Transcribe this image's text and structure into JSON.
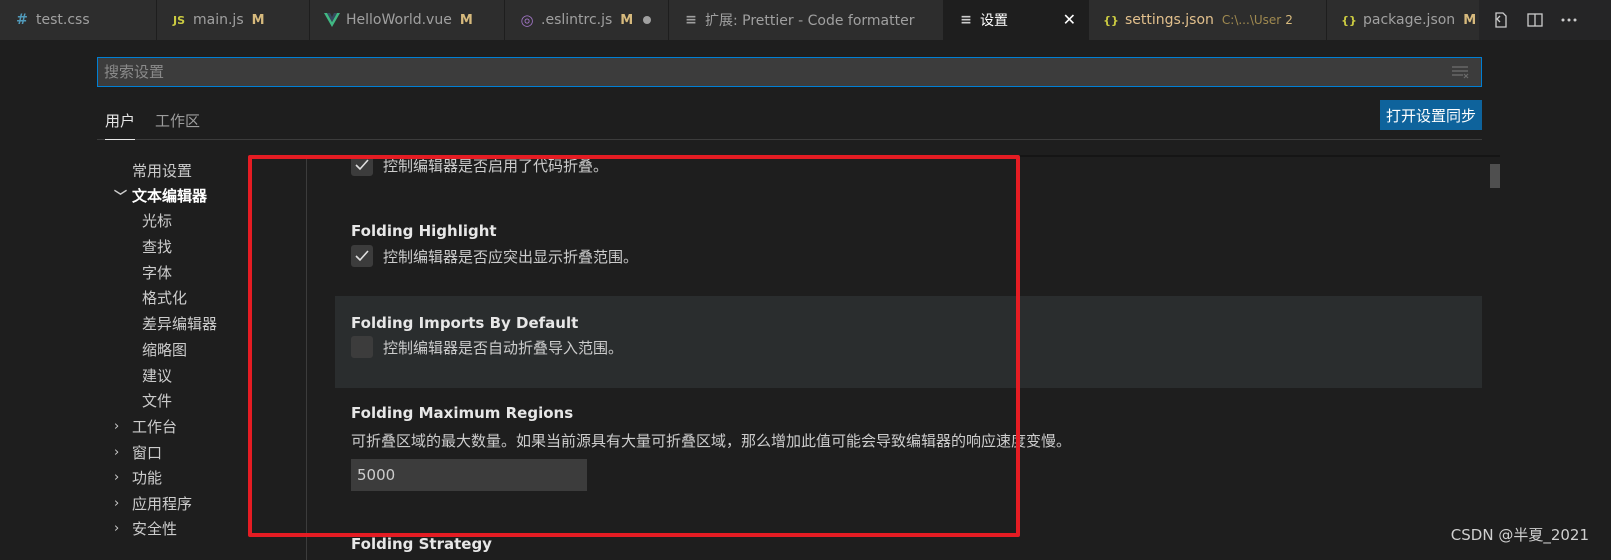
{
  "tabs": [
    {
      "label": "test.css",
      "icon": "#",
      "icon_color": "#519aba",
      "modified": ""
    },
    {
      "label": "main.js",
      "icon": "JS",
      "icon_color": "#cbcb41",
      "modified": "M"
    },
    {
      "label": "HelloWorld.vue",
      "icon": "V",
      "icon_color": "#8dc149",
      "modified": "M"
    },
    {
      "label": ".eslintrc.js",
      "icon": "◎",
      "icon_color": "#a074c4",
      "modified": "M"
    },
    {
      "label": "扩展: Prettier - Code formatter",
      "icon": "≡",
      "icon_color": "#a0a0a0",
      "modified": ""
    },
    {
      "label": "设置",
      "icon": "≡",
      "icon_color": "#cccccc",
      "modified": "",
      "close": "✕"
    },
    {
      "label": "settings.json",
      "sub": "C:\\...\\User",
      "count": "2",
      "icon": "{}",
      "icon_color": "#cbcb41"
    },
    {
      "label": "package.json",
      "icon": "{}",
      "icon_color": "#cbcb41",
      "modified": "M"
    }
  ],
  "search": {
    "placeholder": "搜索设置"
  },
  "scope": {
    "user": "用户",
    "workspace": "工作区",
    "sync_button": "打开设置同步"
  },
  "toc": [
    {
      "label": "常用设置",
      "chevron": ""
    },
    {
      "label": "文本编辑器",
      "chevron": "﹀"
    },
    {
      "label": "光标",
      "chevron": ""
    },
    {
      "label": "查找",
      "chevron": ""
    },
    {
      "label": "字体",
      "chevron": ""
    },
    {
      "label": "格式化",
      "chevron": ""
    },
    {
      "label": "差异编辑器",
      "chevron": ""
    },
    {
      "label": "缩略图",
      "chevron": ""
    },
    {
      "label": "建议",
      "chevron": ""
    },
    {
      "label": "文件",
      "chevron": ""
    },
    {
      "label": "工作台",
      "chevron": "›"
    },
    {
      "label": "窗口",
      "chevron": "›"
    },
    {
      "label": "功能",
      "chevron": "›"
    },
    {
      "label": "应用程序",
      "chevron": "›"
    },
    {
      "label": "安全性",
      "chevron": "›"
    }
  ],
  "settings": {
    "folding_enabled": {
      "desc": "控制编辑器是否启用了代码折叠。",
      "checked": true
    },
    "folding_highlight": {
      "title": "Folding Highlight",
      "desc": "控制编辑器是否应突出显示折叠范围。",
      "checked": true
    },
    "folding_imports": {
      "title": "Folding Imports By Default",
      "desc": "控制编辑器是否自动折叠导入范围。",
      "checked": false
    },
    "folding_max_regions": {
      "title": "Folding Maximum Regions",
      "desc": "可折叠区域的最大数量。如果当前源具有大量可折叠区域，那么增加此值可能会导致编辑器的响应速度变慢。",
      "value": "5000"
    },
    "folding_strategy": {
      "title": "Folding Strategy"
    }
  },
  "watermark": "CSDN @半夏_2021"
}
